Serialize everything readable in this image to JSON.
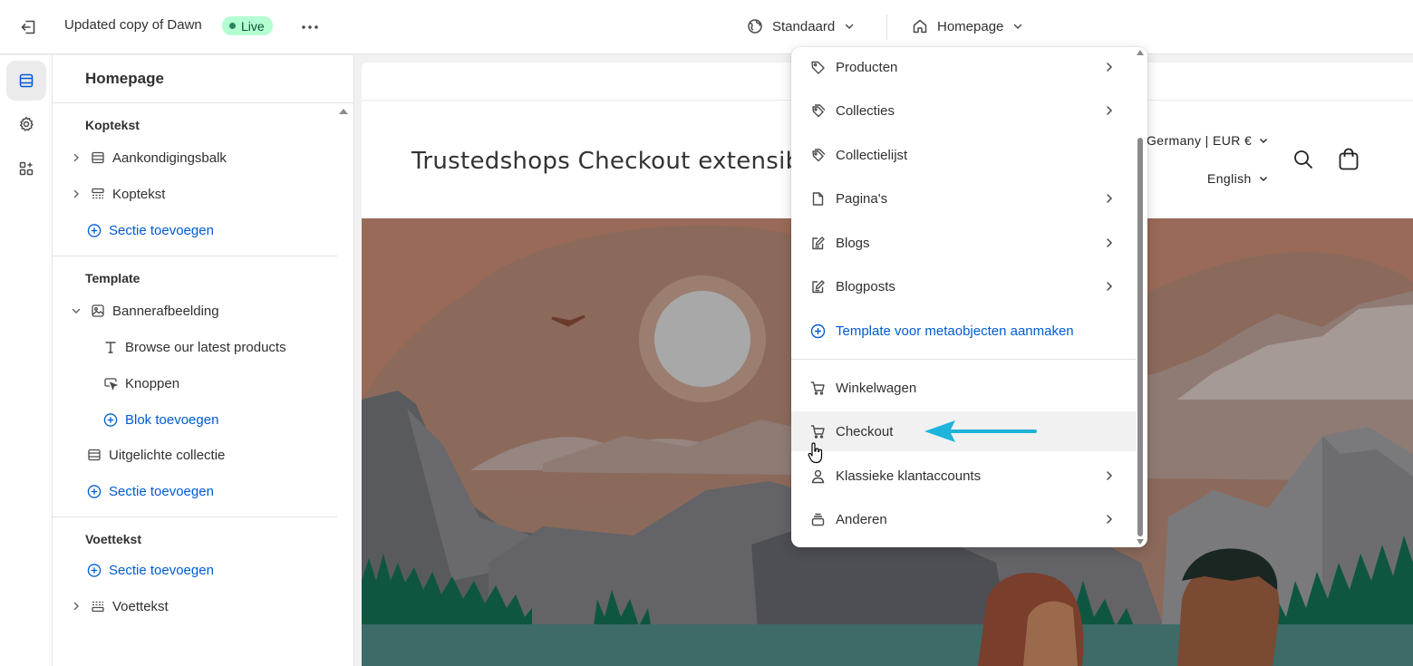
{
  "topbar": {
    "theme_name": "Updated copy of Dawn",
    "status": "Live",
    "market_selector": "Standaard",
    "page_selector": "Homepage"
  },
  "sidebar": {
    "title": "Homepage",
    "groups": {
      "header": {
        "title": "Koptekst",
        "items": [
          "Aankondigingsbalk",
          "Koptekst"
        ],
        "add": "Sectie toevoegen"
      },
      "template": {
        "title": "Template",
        "section": "Bannerafbeelding",
        "blocks": [
          "Browse our latest products",
          "Knoppen"
        ],
        "add_block": "Blok toevoegen",
        "section2": "Uitgelichte collectie",
        "add": "Sectie toevoegen"
      },
      "footer": {
        "title": "Voettekst",
        "add": "Sectie toevoegen",
        "items": [
          "Voettekst"
        ]
      }
    }
  },
  "preview": {
    "store_title": "Trustedshops Checkout extensibilit",
    "country": "Germany | EUR €",
    "language": "English",
    "colors": {
      "sky": "#9a6a58",
      "sun": "#a8a8a8",
      "mountain_dark": "#585a5e",
      "mountain_mid": "#7a7a7d",
      "trees": "#0e5641",
      "water": "#3e6b67"
    }
  },
  "dropdown": {
    "items": [
      {
        "label": "Producten",
        "icon": "tag-icon",
        "has_submenu": true
      },
      {
        "label": "Collecties",
        "icon": "tags-icon",
        "has_submenu": true
      },
      {
        "label": "Collectielijst",
        "icon": "tags-icon",
        "has_submenu": false
      },
      {
        "label": "Pagina's",
        "icon": "page-icon",
        "has_submenu": true
      },
      {
        "label": "Blogs",
        "icon": "blog-icon",
        "has_submenu": true
      },
      {
        "label": "Blogposts",
        "icon": "blog-icon",
        "has_submenu": true
      },
      {
        "label": "Template voor metaobjecten aanmaken",
        "icon": "plus-circle-icon",
        "has_submenu": false
      },
      {
        "label": "Winkelwagen",
        "icon": "cart-icon",
        "has_submenu": false
      },
      {
        "label": "Checkout",
        "icon": "cart-icon",
        "has_submenu": false
      },
      {
        "label": "Klassieke klantaccounts",
        "icon": "person-icon",
        "has_submenu": true
      },
      {
        "label": "Anderen",
        "icon": "stack-icon",
        "has_submenu": true
      }
    ]
  },
  "accent_colors": {
    "link": "#005bd3",
    "live_badge": "#b4fed2",
    "annotation_arrow": "#1eb4dc"
  }
}
